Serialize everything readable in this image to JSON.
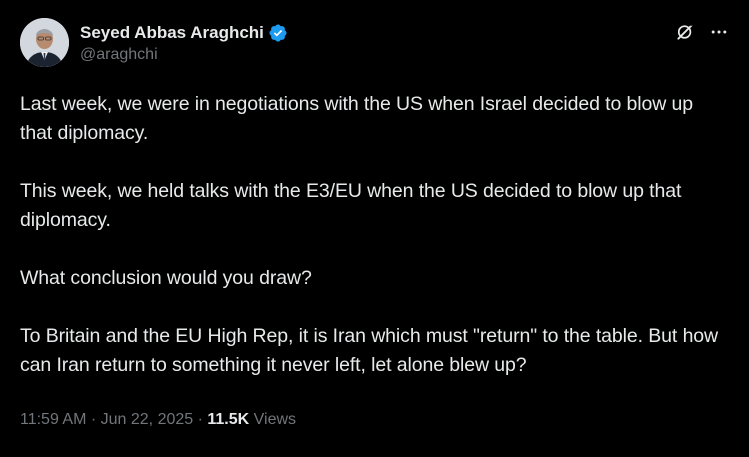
{
  "author": {
    "display_name": "Seyed Abbas Araghchi",
    "handle": "@araghchi",
    "verified": true,
    "verified_color": "#1d9bf0"
  },
  "actions": {
    "grok_icon": "grok-icon",
    "more_icon": "more-options-icon"
  },
  "tweet": {
    "paragraphs": [
      "Last week, we were in negotiations with the US when Israel decided to blow up that diplomacy.",
      "This week, we held talks with the E3/EU when the US decided to blow up that diplomacy.",
      "What conclusion would you draw?",
      "To Britain and the EU High Rep, it is Iran which must \"return\" to the table. But how can Iran return to something it never left, let alone blew up?"
    ]
  },
  "meta": {
    "time": "11:59 AM",
    "separator": " · ",
    "date": "Jun 22, 2025",
    "views_count": "11.5K",
    "views_label": "Views"
  },
  "colors": {
    "background": "#000000",
    "text": "#e7e9ea",
    "muted": "#71767b"
  }
}
